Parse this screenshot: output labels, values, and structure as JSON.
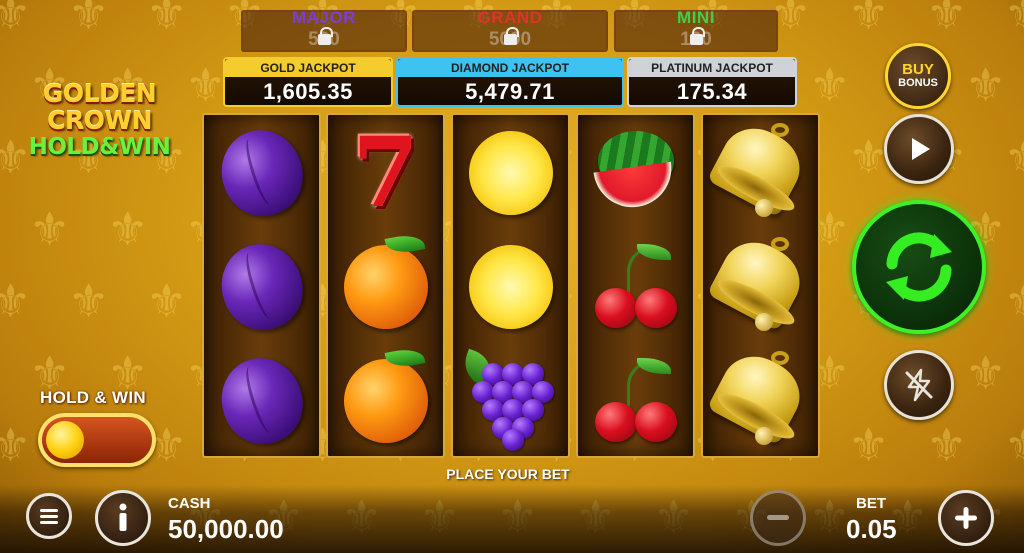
{
  "game": {
    "logo": {
      "line1": "GOLDEN",
      "line2": "CROWN",
      "line3": "HOLD&WIN"
    }
  },
  "locked_jackpots": [
    {
      "name": "MAJOR",
      "value": "500",
      "name_color": "#7a3fd8",
      "locked": true
    },
    {
      "name": "GRAND",
      "value": "5000",
      "name_color": "#e0322a",
      "locked": true
    },
    {
      "name": "MINI",
      "value": "100",
      "name_color": "#3fd248",
      "locked": true
    }
  ],
  "jackpots": [
    {
      "name": "GOLD JACKPOT",
      "amount": "1,605.35",
      "color": "#f4cc2e"
    },
    {
      "name": "DIAMOND JACKPOT",
      "amount": "5,479.71",
      "color": "#3ec2f2"
    },
    {
      "name": "PLATINUM JACKPOT",
      "amount": "175.34",
      "color": "#cfd3d8"
    }
  ],
  "reels": [
    [
      "plum",
      "plum",
      "plum"
    ],
    [
      "seven",
      "orange",
      "orange"
    ],
    [
      "lemon",
      "lemon",
      "grapes"
    ],
    [
      "watermelon",
      "cherry",
      "cherry"
    ],
    [
      "bell",
      "bell",
      "bell"
    ]
  ],
  "buy_bonus": {
    "line1": "BUY",
    "line2": "BONUS"
  },
  "hold_and_win": {
    "label": "HOLD & WIN",
    "enabled": false
  },
  "status": {
    "message": "PLACE YOUR BET"
  },
  "cash": {
    "label": "CASH",
    "value": "50,000.00"
  },
  "bet": {
    "label": "BET",
    "value": "0.05"
  },
  "icons": {
    "menu": "menu-icon",
    "info": "info-icon",
    "play": "play-icon",
    "spin": "spin-icon",
    "turbo": "turbo-off-icon",
    "minus": "minus-icon",
    "plus": "plus-icon",
    "lock": "lock-icon"
  }
}
